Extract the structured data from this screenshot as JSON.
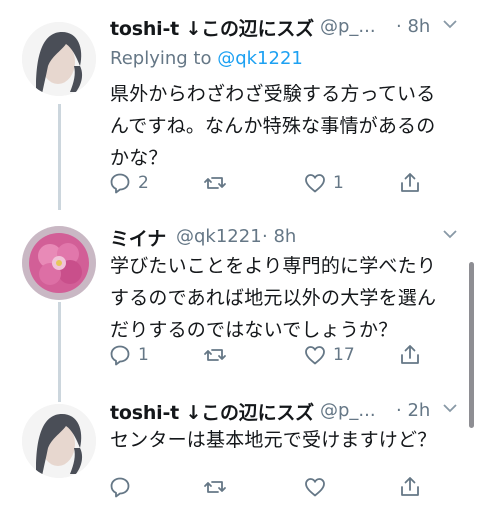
{
  "tweets": [
    {
      "name": "toshi-t ↓この辺にスズ",
      "handle": "@p_...",
      "time": "· 8h",
      "replying_prefix": "Replying to ",
      "replying_mention": "@qk1221",
      "text_lines": [
        "県外からわざわざ受験する方っているんですね。なんか特殊な事情があるの",
        "かな？"
      ],
      "line1": "県外からわざわざ受験する方っているんですね。なんか特殊な事情があるの",
      "replies": "2",
      "retweets": "",
      "likes": "1"
    },
    {
      "name": "ミイナ",
      "handle": "@qk1221",
      "time": "· 8h",
      "line1": "学びたいことをより専門的に学べたり",
      "line2": "するのであれば地元以外の大学を選ん",
      "line3": "だりするのではないでしょうか？",
      "replies": "1",
      "retweets": "",
      "likes": "17"
    },
    {
      "name": "toshi-t ↓この辺にスズ",
      "handle": "@p_...",
      "time": "· 2h",
      "line1": "センターは基本地元で受けますけど？",
      "replies": "",
      "retweets": "",
      "likes": ""
    }
  ],
  "colors": {
    "text": "#14171a",
    "secondary": "#657786",
    "link": "#1da1f2",
    "thread": "#ccd6dd"
  },
  "icons": [
    "reply-icon",
    "retweet-icon",
    "like-icon",
    "share-icon",
    "chevron-down-icon"
  ]
}
